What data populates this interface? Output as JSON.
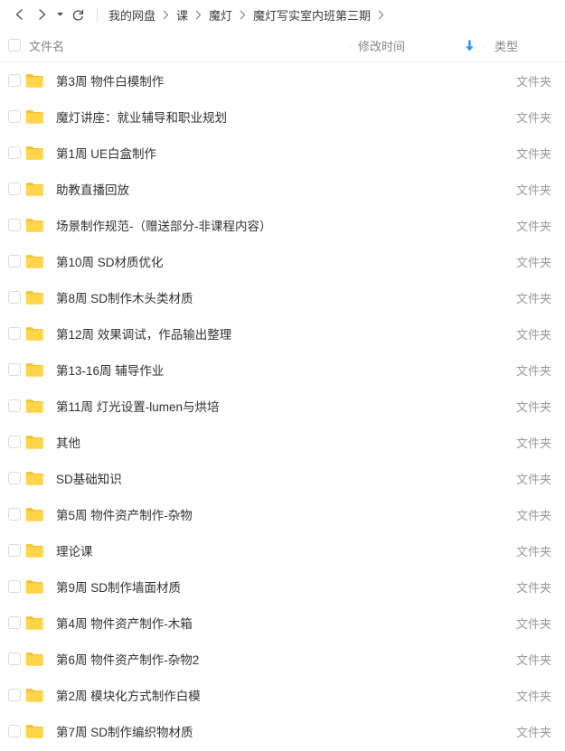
{
  "toolbar": {
    "back_icon": "chevron-left-icon",
    "forward_icon": "chevron-right-icon",
    "history_caret_icon": "caret-down-icon",
    "refresh_icon": "refresh-icon"
  },
  "breadcrumb": {
    "separator": "›",
    "items": [
      {
        "label": "我的网盘"
      },
      {
        "label": "课"
      },
      {
        "label": "魔灯"
      },
      {
        "label": "魔灯写实室内班第三期"
      }
    ]
  },
  "columns": {
    "name": "文件名",
    "modified": "修改时间",
    "type": "类型",
    "sort_indicator": "↓",
    "sort_color": "#2196f3"
  },
  "colors": {
    "folder_top": "#fdd75a",
    "folder_body": "#ffd44d",
    "accent": "#2196f3",
    "text": "#333333",
    "muted": "#9a9a9a",
    "border": "#eeeeee"
  },
  "files": [
    {
      "name": "第3周 物件白模制作",
      "modified": "",
      "type": "文件夹",
      "icon": "folder-icon"
    },
    {
      "name": "魔灯讲座：就业辅导和职业规划",
      "modified": "",
      "type": "文件夹",
      "icon": "folder-icon"
    },
    {
      "name": "第1周 UE白盒制作",
      "modified": "",
      "type": "文件夹",
      "icon": "folder-icon"
    },
    {
      "name": "助教直播回放",
      "modified": "",
      "type": "文件夹",
      "icon": "folder-icon"
    },
    {
      "name": "场景制作规范-（赠送部分-非课程内容）",
      "modified": "",
      "type": "文件夹",
      "icon": "folder-icon"
    },
    {
      "name": "第10周 SD材质优化",
      "modified": "",
      "type": "文件夹",
      "icon": "folder-icon"
    },
    {
      "name": "第8周 SD制作木头类材质",
      "modified": "",
      "type": "文件夹",
      "icon": "folder-icon"
    },
    {
      "name": "第12周 效果调试，作品输出整理",
      "modified": "",
      "type": "文件夹",
      "icon": "folder-icon"
    },
    {
      "name": "第13-16周 辅导作业",
      "modified": "",
      "type": "文件夹",
      "icon": "folder-icon"
    },
    {
      "name": "第11周 灯光设置-lumen与烘培",
      "modified": "",
      "type": "文件夹",
      "icon": "folder-icon"
    },
    {
      "name": "其他",
      "modified": "",
      "type": "文件夹",
      "icon": "folder-icon"
    },
    {
      "name": "SD基础知识",
      "modified": "",
      "type": "文件夹",
      "icon": "folder-icon"
    },
    {
      "name": "第5周 物件资产制作-杂物",
      "modified": "",
      "type": "文件夹",
      "icon": "folder-icon"
    },
    {
      "name": "理论课",
      "modified": "",
      "type": "文件夹",
      "icon": "folder-icon"
    },
    {
      "name": "第9周 SD制作墙面材质",
      "modified": "",
      "type": "文件夹",
      "icon": "folder-icon"
    },
    {
      "name": "第4周 物件资产制作-木箱",
      "modified": "",
      "type": "文件夹",
      "icon": "folder-icon"
    },
    {
      "name": "第6周 物件资产制作-杂物2",
      "modified": "",
      "type": "文件夹",
      "icon": "folder-icon"
    },
    {
      "name": "第2周 模块化方式制作白模",
      "modified": "",
      "type": "文件夹",
      "icon": "folder-icon"
    },
    {
      "name": "第7周 SD制作编织物材质",
      "modified": "",
      "type": "文件夹",
      "icon": "folder-icon"
    }
  ]
}
